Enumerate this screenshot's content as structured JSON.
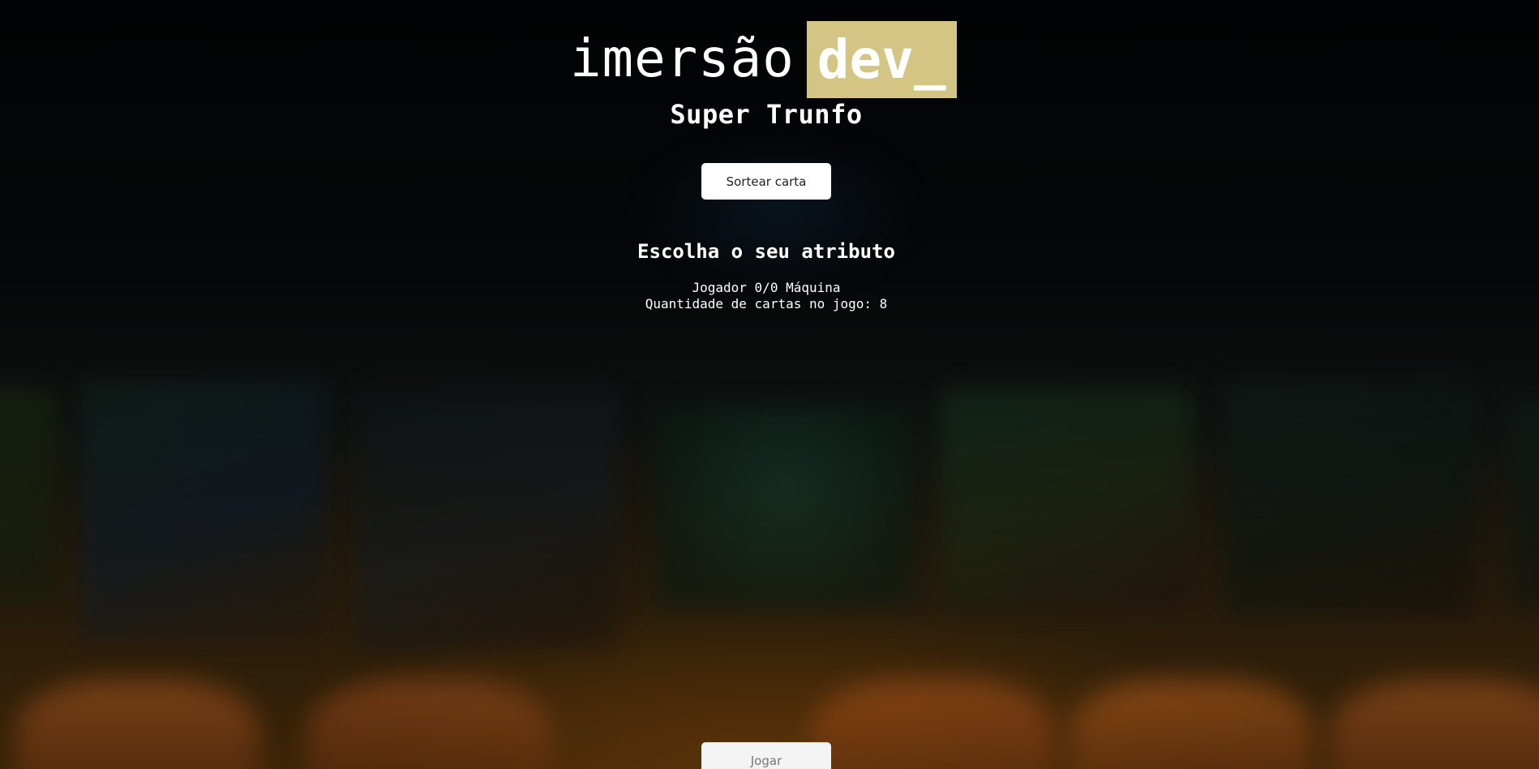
{
  "logo": {
    "word": "imersão",
    "highlight": "dev_"
  },
  "title": "Super Trunfo",
  "buttons": {
    "draw_card": "Sortear carta",
    "play": "Jogar"
  },
  "choose_attribute": "Escolha o seu atributo",
  "score": {
    "line": "Jogador 0/0 Máquina",
    "cards_in_game": "Quantidade de cartas no jogo: 8"
  },
  "colors": {
    "accent": "#d4c584",
    "button_bg": "#ffffff",
    "page_bg": "#000000"
  }
}
